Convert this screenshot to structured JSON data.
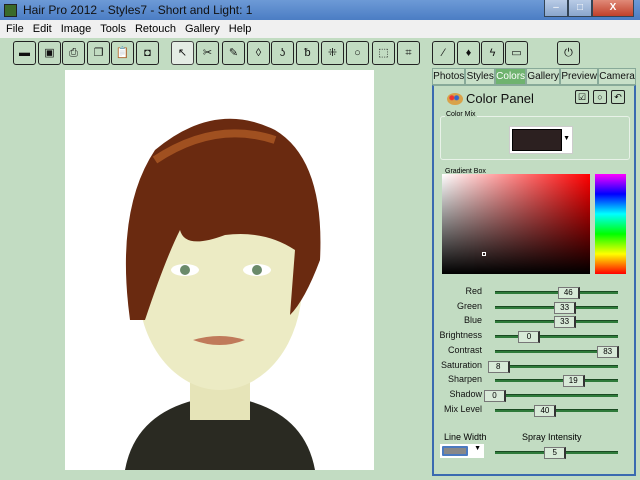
{
  "window": {
    "title": "Hair Pro 2012 - Styles7 - Short and Light: 1",
    "minimize": "–",
    "maximize": "□",
    "close": "X"
  },
  "menu": [
    "File",
    "Edit",
    "Image",
    "Tools",
    "Retouch",
    "Gallery",
    "Help"
  ],
  "toolbar": [
    {
      "name": "open-icon",
      "glyph": "▬"
    },
    {
      "name": "save-icon",
      "glyph": "▣"
    },
    {
      "name": "print-icon",
      "glyph": "⎙"
    },
    {
      "name": "copy-icon",
      "glyph": "❐"
    },
    {
      "name": "paste-icon",
      "glyph": "📋"
    },
    {
      "name": "camera-icon",
      "glyph": "◘"
    },
    {
      "name": "pointer-icon",
      "glyph": "↖"
    },
    {
      "name": "scissors-icon",
      "glyph": "✂"
    },
    {
      "name": "eyedropper-icon",
      "glyph": "✎"
    },
    {
      "name": "drop-icon",
      "glyph": "◊"
    },
    {
      "name": "hairdryer-icon",
      "glyph": "ʖ"
    },
    {
      "name": "brush-curl-icon",
      "glyph": "ᵬ"
    },
    {
      "name": "spray-icon",
      "glyph": "⁜"
    },
    {
      "name": "lasso-icon",
      "glyph": "○"
    },
    {
      "name": "rect-select-icon",
      "glyph": "⬚"
    },
    {
      "name": "crop-icon",
      "glyph": "⌗"
    },
    {
      "name": "magic-wand-icon",
      "glyph": "⁄"
    },
    {
      "name": "paint-brush-icon",
      "glyph": "♦"
    },
    {
      "name": "lightning-icon",
      "glyph": "ϟ"
    },
    {
      "name": "tape-icon",
      "glyph": "▭"
    },
    {
      "name": "power-icon",
      "glyph": "⏻"
    }
  ],
  "tabs": [
    "Photos",
    "Styles",
    "Colors",
    "Gallery",
    "Preview",
    "Camera"
  ],
  "panel": {
    "title": "Color Panel",
    "color_mix_label": "Color Mix",
    "mix_color": "#2c2020",
    "gradient_label": "Gradient Box",
    "sliders": [
      {
        "label": "Red",
        "value": 46
      },
      {
        "label": "Green",
        "value": 33
      },
      {
        "label": "Blue",
        "value": 33
      },
      {
        "label": "Brightness",
        "value": 0
      },
      {
        "label": "Contrast",
        "value": 83
      },
      {
        "label": "Saturation",
        "value": 8
      },
      {
        "label": "Sharpen",
        "value": 19
      },
      {
        "label": "Shadow",
        "value": 0
      },
      {
        "label": "Mix Level",
        "value": 40
      }
    ],
    "line_width_label": "Line Width",
    "spray_label": "Spray Intensity",
    "spray_value": 5
  }
}
